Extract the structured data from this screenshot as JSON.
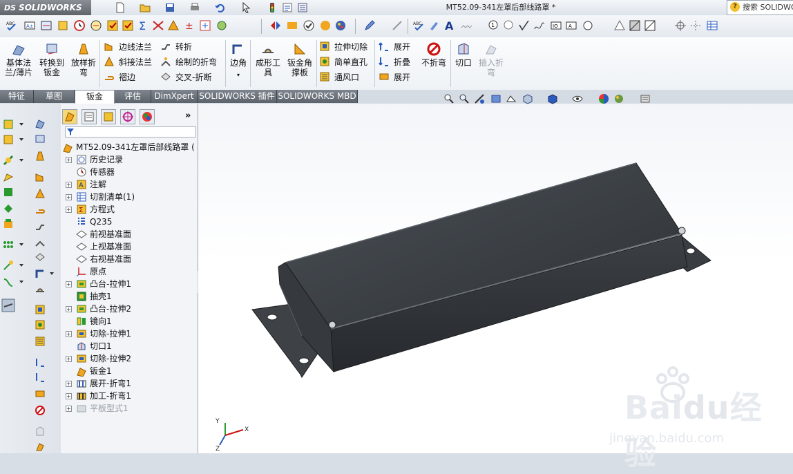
{
  "app": {
    "brand": "SOLIDWORKS",
    "brand_mark": "DS"
  },
  "window": {
    "title": "MT52.09-341左罩后部线路罩 *"
  },
  "search": {
    "label": "搜索 SOLIDWO"
  },
  "command_manager": {
    "big_buttons": [
      {
        "id": "base-flange",
        "label": "基体法\n兰/薄片"
      },
      {
        "id": "convert-to-sheetmetal",
        "label": "转换到\n钣金"
      },
      {
        "id": "lofted-bend",
        "label": "放样折\n弯"
      },
      {
        "id": "corners",
        "label": "边角"
      },
      {
        "id": "forming-tool",
        "label": "成形工\n具"
      },
      {
        "id": "sheetmetal-gusset",
        "label": "钣金角\n撑板"
      },
      {
        "id": "no-bend",
        "label": "不折弯"
      },
      {
        "id": "rip",
        "label": "切口"
      },
      {
        "id": "insert-bends",
        "label": "插入折\n弯"
      }
    ],
    "small_buttons": [
      {
        "id": "edge-flange",
        "label": "边线法兰"
      },
      {
        "id": "miter-flange",
        "label": "斜接法兰"
      },
      {
        "id": "hem",
        "label": "褶边"
      },
      {
        "id": "jog",
        "label": "转折"
      },
      {
        "id": "sketched-bend",
        "label": "绘制的折弯"
      },
      {
        "id": "cross-break",
        "label": "交叉-折断"
      },
      {
        "id": "extruded-cut",
        "label": "拉伸切除"
      },
      {
        "id": "simple-hole",
        "label": "简单直孔"
      },
      {
        "id": "vent",
        "label": "通风口"
      },
      {
        "id": "unfold",
        "label": "展开"
      },
      {
        "id": "fold",
        "label": "折叠"
      },
      {
        "id": "flatten",
        "label": "展开"
      }
    ]
  },
  "tabs": [
    {
      "label": "特征",
      "active": false
    },
    {
      "label": "草图",
      "active": false
    },
    {
      "label": "钣金",
      "active": true
    },
    {
      "label": "评估",
      "active": false
    },
    {
      "label": "DimXpert",
      "active": false
    },
    {
      "label": "SOLIDWORKS 插件",
      "active": false
    },
    {
      "label": "SOLIDWORKS MBD",
      "active": false
    }
  ],
  "tree": {
    "root": "MT52.09-341左罩后部线路罩  (",
    "items": [
      {
        "label": "历史记录",
        "icon": "history-icon",
        "expandable": true,
        "dim": false
      },
      {
        "label": "传感器",
        "icon": "sensor-icon",
        "expandable": false,
        "dim": false
      },
      {
        "label": "注解",
        "icon": "annotation-icon",
        "expandable": true,
        "dim": false
      },
      {
        "label": "切割清单(1)",
        "icon": "cut-list-icon",
        "expandable": true,
        "dim": false
      },
      {
        "label": "方程式",
        "icon": "equation-icon",
        "expandable": true,
        "dim": false
      },
      {
        "label": "Q235",
        "icon": "material-icon",
        "expandable": false,
        "dim": false
      },
      {
        "label": "前视基准面",
        "icon": "plane-icon",
        "expandable": false,
        "dim": false
      },
      {
        "label": "上视基准面",
        "icon": "plane-icon",
        "expandable": false,
        "dim": false
      },
      {
        "label": "右视基准面",
        "icon": "plane-icon",
        "expandable": false,
        "dim": false
      },
      {
        "label": "原点",
        "icon": "origin-icon",
        "expandable": false,
        "dim": false
      },
      {
        "label": "凸台-拉伸1",
        "icon": "boss-extrude-icon",
        "expandable": true,
        "dim": false
      },
      {
        "label": "抽壳1",
        "icon": "shell-icon",
        "expandable": false,
        "dim": false
      },
      {
        "label": "凸台-拉伸2",
        "icon": "boss-extrude-icon",
        "expandable": true,
        "dim": false
      },
      {
        "label": "镜向1",
        "icon": "mirror-icon",
        "expandable": false,
        "dim": false
      },
      {
        "label": "切除-拉伸1",
        "icon": "cut-extrude-icon",
        "expandable": true,
        "dim": false
      },
      {
        "label": "切口1",
        "icon": "rip-icon",
        "expandable": false,
        "dim": false
      },
      {
        "label": "切除-拉伸2",
        "icon": "cut-extrude-icon",
        "expandable": true,
        "dim": false
      },
      {
        "label": "钣金1",
        "icon": "sheetmetal-icon",
        "expandable": false,
        "dim": false
      },
      {
        "label": "展开-折弯1",
        "icon": "flatten-bends-icon",
        "expandable": true,
        "dim": false
      },
      {
        "label": "加工-折弯1",
        "icon": "process-bends-icon",
        "expandable": true,
        "dim": false
      },
      {
        "label": "平板型式1",
        "icon": "flat-pattern-icon",
        "expandable": true,
        "dim": true
      }
    ]
  },
  "triad": {
    "x": "X",
    "y": "Y",
    "z": "Z"
  },
  "watermark": {
    "brand_a": "Bai",
    "brand_b": "du",
    "brand_c": "经验",
    "url": "jingyan.baidu.com"
  },
  "colors": {
    "accent": "#f2a51e",
    "active_tab": "#ffffff",
    "part": "#3b3f44",
    "tree_bg": "#f2f4f7"
  }
}
